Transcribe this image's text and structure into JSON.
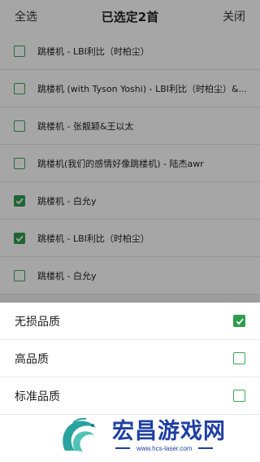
{
  "header": {
    "select_all": "全选",
    "title": "已选定2首",
    "close": "关闭"
  },
  "songs": [
    {
      "title": "跳楼机 - LBI利比（时柏尘）",
      "checked": false
    },
    {
      "title": "跳楼机 (with Tyson Yoshi) - LBI利比（时柏尘）&...",
      "checked": false
    },
    {
      "title": "跳楼机 - 张靓颖&王以太",
      "checked": false
    },
    {
      "title": "跳楼机(我们的感情好像跳楼机) - 陆杰awr",
      "checked": false
    },
    {
      "title": "跳楼机 - 白允y",
      "checked": true
    },
    {
      "title": "跳楼机 - LBI利比（时柏尘）",
      "checked": true
    },
    {
      "title": "跳楼机 - 白允y",
      "checked": false
    }
  ],
  "quality_options": [
    {
      "label": "无损品质",
      "checked": true
    },
    {
      "label": "高品质",
      "checked": false
    },
    {
      "label": "标准品质",
      "checked": false
    }
  ],
  "watermark": {
    "name": "宏昌游戏网",
    "url": "www.hcs-laser.com"
  },
  "colors": {
    "accent": "#2f9d4f",
    "watermark": "#1f3fa3"
  }
}
